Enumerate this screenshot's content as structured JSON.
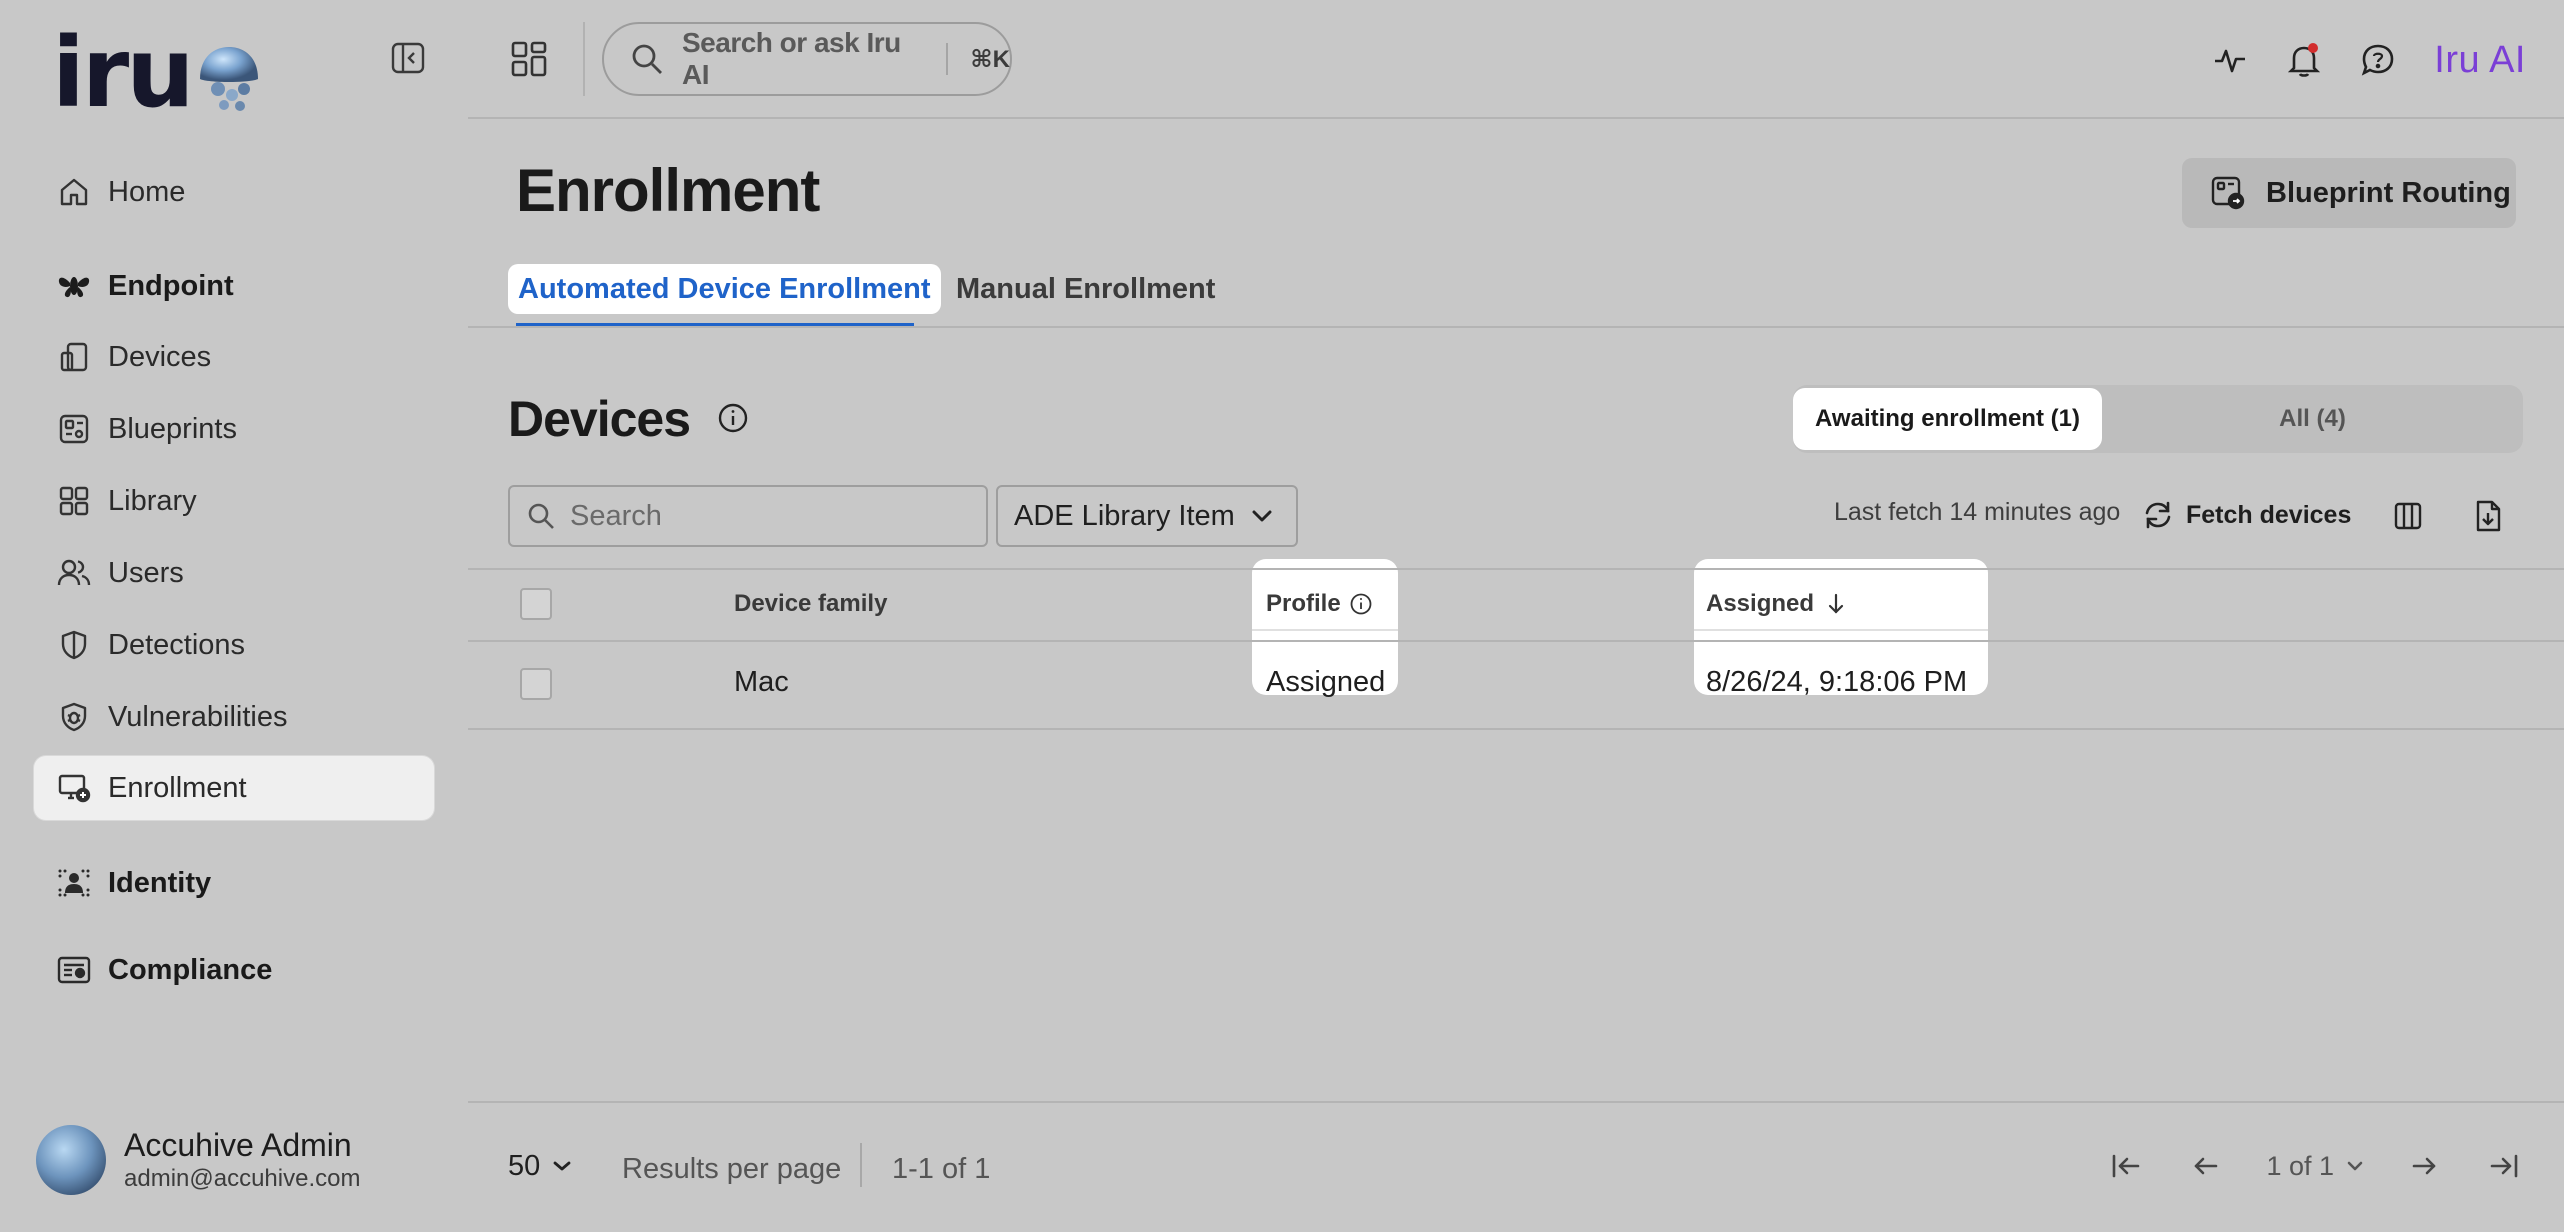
{
  "brand": {
    "wordmark": "iru"
  },
  "sidebar": {
    "items": [
      {
        "label": "Home",
        "icon": "home-icon"
      },
      {
        "label": "Endpoint",
        "icon": "endpoint-icon",
        "section": true
      },
      {
        "label": "Devices",
        "icon": "devices-icon"
      },
      {
        "label": "Blueprints",
        "icon": "blueprints-icon"
      },
      {
        "label": "Library",
        "icon": "library-icon"
      },
      {
        "label": "Users",
        "icon": "users-icon"
      },
      {
        "label": "Detections",
        "icon": "shield-icon"
      },
      {
        "label": "Vulnerabilities",
        "icon": "vulnerabilities-icon"
      },
      {
        "label": "Enrollment",
        "icon": "enrollment-icon",
        "active": true
      },
      {
        "label": "Identity",
        "icon": "identity-icon",
        "section": true
      },
      {
        "label": "Compliance",
        "icon": "compliance-icon",
        "section": true
      }
    ],
    "user": {
      "name": "Accuhive Admin",
      "email": "admin@accuhive.com"
    }
  },
  "topbar": {
    "search_placeholder": "Search or ask Iru AI",
    "shortcut": "⌘K",
    "ai_label": "Iru AI",
    "ai_color": "#7b3fd6"
  },
  "page": {
    "title": "Enrollment",
    "blueprint_routing": "Blueprint Routing",
    "tabs": [
      {
        "label": "Automated Device Enrollment",
        "active": true
      },
      {
        "label": "Manual Enrollment",
        "active": false
      }
    ],
    "accent_color": "#1f63c9"
  },
  "devices": {
    "title": "Devices",
    "segments": [
      {
        "label": "Awaiting enrollment (1)",
        "active": true
      },
      {
        "label": "All (4)",
        "active": false
      }
    ],
    "search_placeholder": "Search",
    "filter_label": "ADE Library Item",
    "last_fetch": "Last fetch 14 minutes ago",
    "fetch_button": "Fetch devices",
    "table": {
      "columns": [
        "Device family",
        "Profile",
        "Assigned"
      ],
      "sort_column": "Assigned",
      "sort_direction": "descending",
      "rows": [
        {
          "device_family": "Mac",
          "profile": "Assigned",
          "assigned": "8/26/24, 9:18:06 PM"
        }
      ]
    }
  },
  "footer": {
    "per_page": "50",
    "per_page_label": "Results per page",
    "range": "1-1 of 1",
    "page_indicator": "1 of 1"
  }
}
